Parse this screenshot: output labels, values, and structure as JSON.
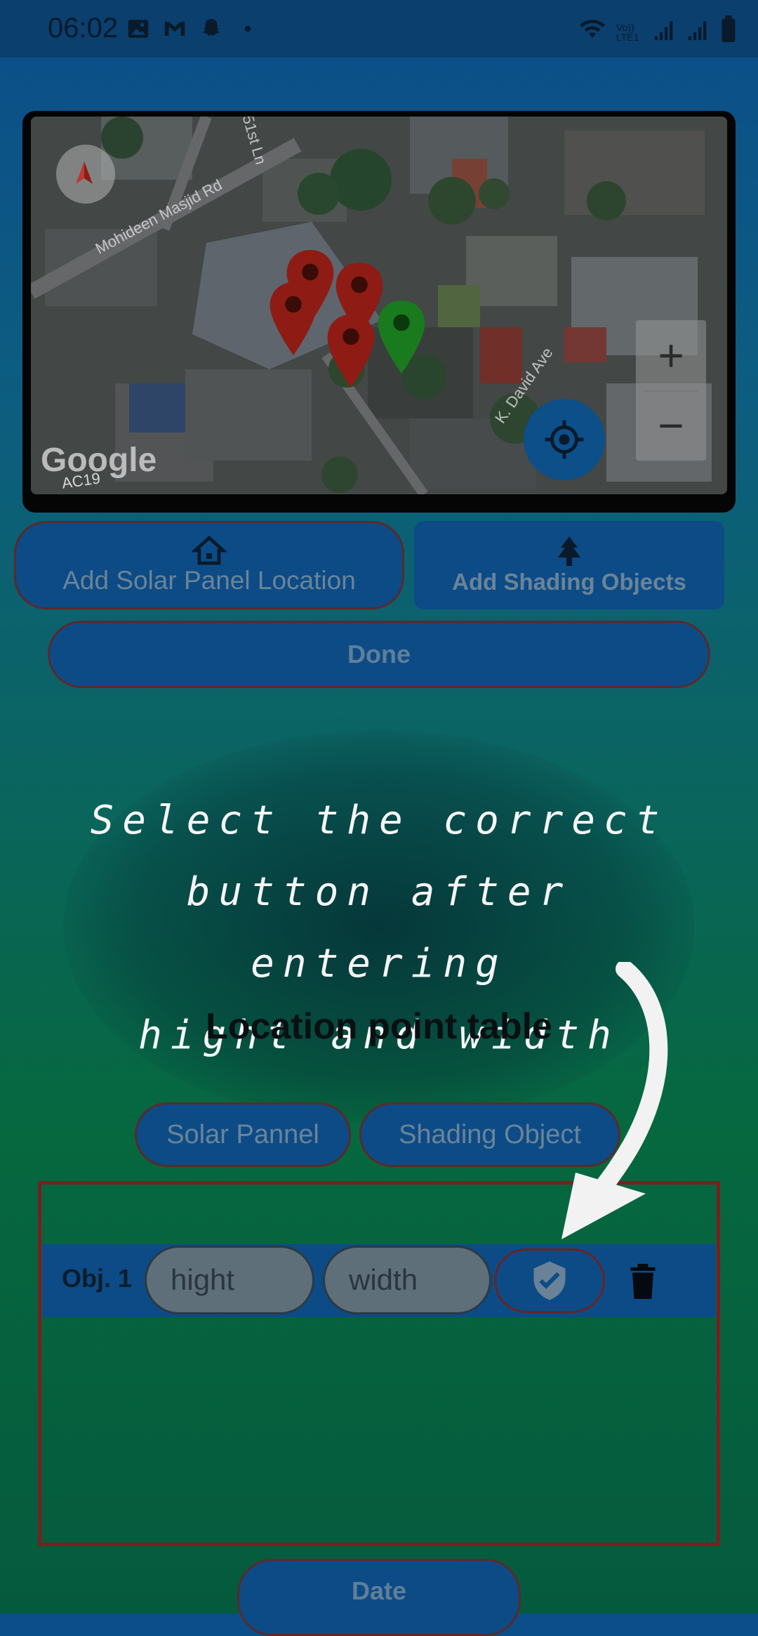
{
  "status_bar": {
    "time": "06:02",
    "network_label": "Vo)) LTE1"
  },
  "map": {
    "logo": "Google",
    "area_code": "AC19",
    "streets": [
      "51st Ln",
      "Mohideen Masjid Rd",
      "K. David Ave"
    ],
    "zoom_in": "+",
    "zoom_out": "−",
    "markers": [
      {
        "color": "#8e1c14"
      },
      {
        "color": "#8e1c14"
      },
      {
        "color": "#8e1c14"
      },
      {
        "color": "#8e1c14"
      },
      {
        "color": "#1a7a1e"
      }
    ]
  },
  "actions": {
    "add_solar_label": "Add Solar Panel Location",
    "add_shading_label": "Add Shading Objects",
    "done_label": "Done"
  },
  "hint": {
    "lines": [
      "Select the correct",
      "button after entering",
      "hight and width"
    ]
  },
  "table": {
    "title": "Location point table",
    "tabs": [
      "Solar Pannel",
      "Shading Object"
    ],
    "rows": [
      {
        "label": "Obj. 1",
        "hight_placeholder": "hight",
        "width_placeholder": "width"
      }
    ]
  },
  "footer": {
    "date_label": "Date"
  },
  "colors": {
    "primary_button": "#0c4b86",
    "button_border": "#5a2a2a",
    "table_border": "#7a1f1f",
    "locate_button": "#0d4f88"
  }
}
